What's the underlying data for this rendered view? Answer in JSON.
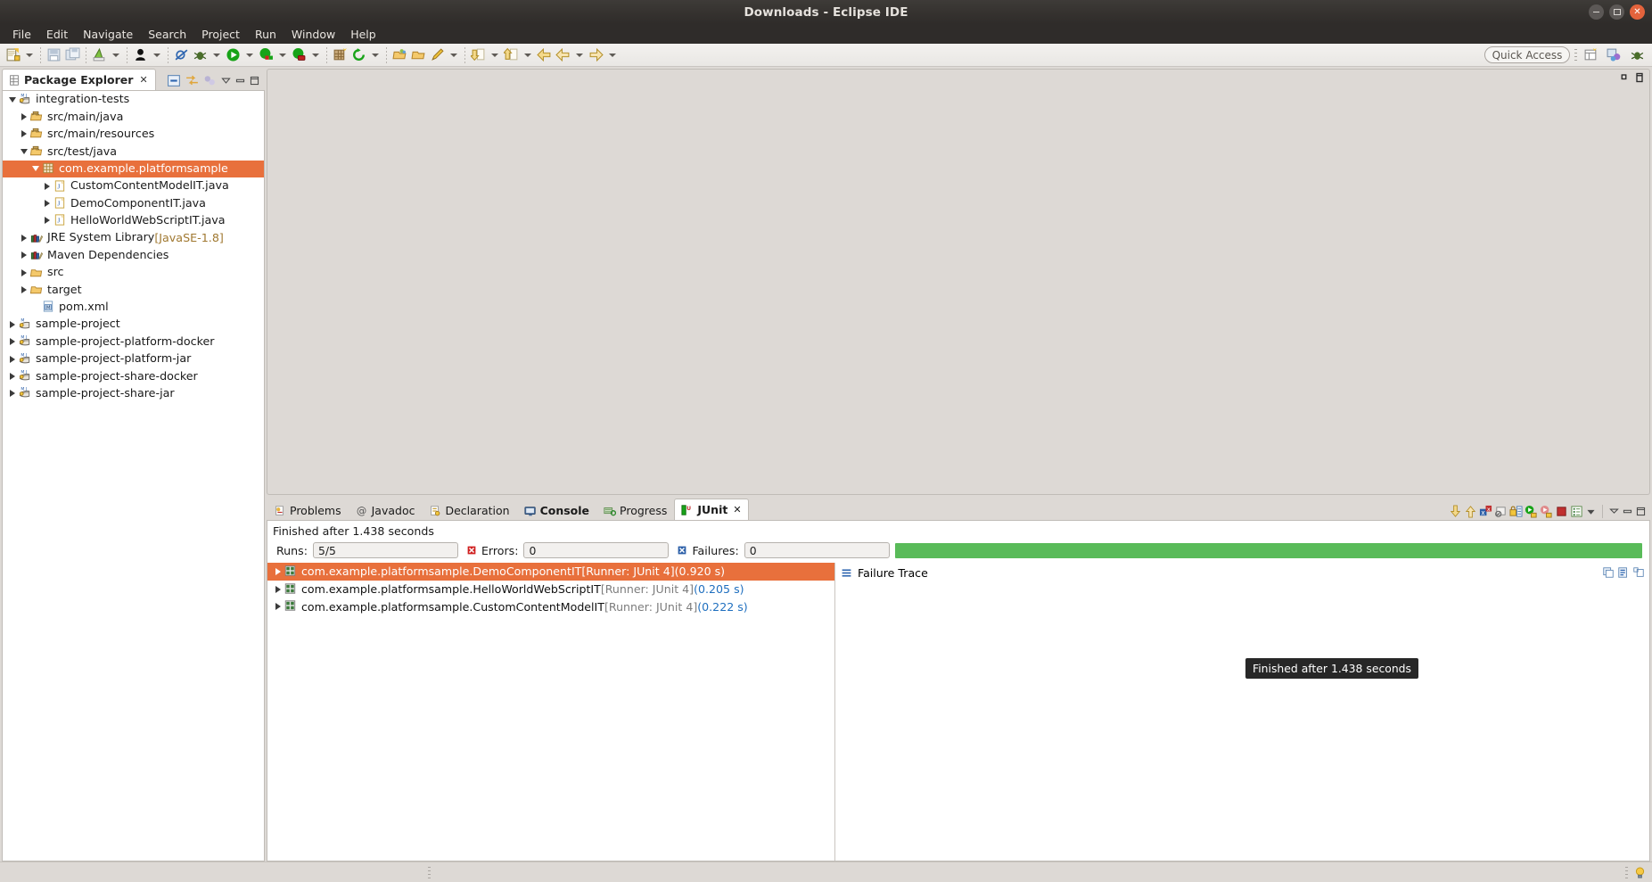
{
  "window": {
    "title": "Downloads - Eclipse IDE",
    "controls": [
      {
        "name": "minimize",
        "glyph": "–"
      },
      {
        "name": "maximize",
        "glyph": "□"
      },
      {
        "name": "close",
        "glyph": "✕"
      }
    ]
  },
  "menubar": {
    "items": [
      "File",
      "Edit",
      "Navigate",
      "Search",
      "Project",
      "Run",
      "Window",
      "Help"
    ]
  },
  "toolbar": {
    "quick_access_placeholder": "Quick Access",
    "groups": [
      {
        "icons": [
          "new-file-icon"
        ],
        "dropdown": true
      },
      {
        "icons": [
          "save-icon",
          "save-all-icon"
        ],
        "dropdown": false
      },
      {
        "icons": [
          "new-java-project-icon"
        ],
        "dropdown": true
      },
      {
        "icons": [
          "run-last-tool-icon"
        ],
        "dropdown": true
      },
      {
        "icons": [
          "skip-breakpoints-icon",
          "debug-icon"
        ],
        "dropdown": true
      },
      {
        "icons": [
          "run-icon"
        ],
        "dropdown": true
      },
      {
        "icons": [
          "coverage-icon"
        ],
        "dropdown": true
      },
      {
        "icons": [
          "run-ant-icon"
        ],
        "dropdown": true
      },
      {
        "icons": [
          "new-class-icon",
          "refresh-icon"
        ],
        "dropdown": true
      },
      {
        "icons": [
          "open-type-icon",
          "open-task-icon",
          "annotation-icon"
        ],
        "dropdown": true
      },
      {
        "icons": [
          "previous-annotation-icon"
        ],
        "dropdown": true
      },
      {
        "icons": [
          "next-annotation-icon"
        ],
        "dropdown": true
      },
      {
        "icons": [
          "back-icon",
          "forward-icon"
        ],
        "dropdown": true
      },
      {
        "icons": [
          "forward-nav-icon"
        ],
        "dropdown": true
      }
    ],
    "perspective_icons": [
      "java-perspective-icon",
      "java-ee-perspective-icon",
      "debug-perspective-icon"
    ]
  },
  "package_explorer": {
    "tab_label": "Package Explorer",
    "tab_icon": "package-explorer-icon",
    "close_glyph": "✕",
    "tools": [
      "collapse-all-icon",
      "link-with-editor-icon",
      "view-filters-icon",
      "view-menu-icon",
      "minimize-icon",
      "maximize-icon"
    ],
    "tree": [
      {
        "label": "integration-tests",
        "indent": 0,
        "twisty": "down",
        "icon": "maven-java-project-icon",
        "selected": false
      },
      {
        "label": "src/main/java",
        "indent": 1,
        "twisty": "right",
        "icon": "source-folder-icon",
        "selected": false
      },
      {
        "label": "src/main/resources",
        "indent": 1,
        "twisty": "right",
        "icon": "source-folder-icon",
        "selected": false
      },
      {
        "label": "src/test/java",
        "indent": 1,
        "twisty": "down",
        "icon": "source-folder-icon",
        "selected": false
      },
      {
        "label": "com.example.platformsample",
        "indent": 2,
        "twisty": "down",
        "icon": "package-icon",
        "selected": true
      },
      {
        "label": "CustomContentModelIT.java",
        "indent": 3,
        "twisty": "right",
        "icon": "java-file-icon",
        "selected": false
      },
      {
        "label": "DemoComponentIT.java",
        "indent": 3,
        "twisty": "right",
        "icon": "java-file-icon",
        "selected": false
      },
      {
        "label": "HelloWorldWebScriptIT.java",
        "indent": 3,
        "twisty": "right",
        "icon": "java-file-icon",
        "selected": false
      },
      {
        "label": "JRE System Library",
        "suffix": " [JavaSE-1.8]",
        "indent": 1,
        "twisty": "right",
        "icon": "library-icon",
        "selected": false
      },
      {
        "label": "Maven Dependencies",
        "indent": 1,
        "twisty": "right",
        "icon": "library-icon",
        "selected": false
      },
      {
        "label": "src",
        "indent": 1,
        "twisty": "right",
        "icon": "folder-icon",
        "selected": false
      },
      {
        "label": "target",
        "indent": 1,
        "twisty": "right",
        "icon": "folder-icon",
        "selected": false
      },
      {
        "label": "pom.xml",
        "indent": 2,
        "twisty": "none",
        "icon": "xml-file-icon",
        "selected": false
      },
      {
        "label": "sample-project",
        "indent": 0,
        "twisty": "right",
        "icon": "maven-project-icon",
        "selected": false
      },
      {
        "label": "sample-project-platform-docker",
        "indent": 0,
        "twisty": "right",
        "icon": "maven-java-project-icon",
        "selected": false
      },
      {
        "label": "sample-project-platform-jar",
        "indent": 0,
        "twisty": "right",
        "icon": "maven-java-project-icon",
        "selected": false
      },
      {
        "label": "sample-project-share-docker",
        "indent": 0,
        "twisty": "right",
        "icon": "maven-java-project-icon",
        "selected": false
      },
      {
        "label": "sample-project-share-jar",
        "indent": 0,
        "twisty": "right",
        "icon": "maven-java-project-icon",
        "selected": false
      }
    ]
  },
  "editor_area": {
    "controls": [
      "restore-icon",
      "maximize-icon"
    ]
  },
  "bottom_tabs": [
    {
      "label": "Problems",
      "icon": "problems-icon",
      "active": false,
      "bold": false
    },
    {
      "label": "Javadoc",
      "icon": "javadoc-icon",
      "active": false,
      "bold": false
    },
    {
      "label": "Declaration",
      "icon": "declaration-icon",
      "active": false,
      "bold": false
    },
    {
      "label": "Console",
      "icon": "console-icon",
      "active": false,
      "bold": true
    },
    {
      "label": "Progress",
      "icon": "progress-icon",
      "active": false,
      "bold": false
    },
    {
      "label": "JUnit",
      "icon": "junit-icon",
      "active": true,
      "bold": true,
      "close_glyph": "✕"
    }
  ],
  "junit": {
    "status_text": "Finished after 1.438 seconds",
    "runs_label": "Runs:",
    "runs_value": "5/5",
    "errors_label": "Errors:",
    "errors_value": "0",
    "failures_label": "Failures:",
    "failures_value": "0",
    "errors_icon": "error-marker-icon",
    "failures_icon": "failure-marker-icon",
    "progress_color": "#59bb59",
    "selection_color": "#e8703c",
    "tooltip_text": "Finished after 1.438 seconds",
    "toolbar_icons": [
      "next-failure-icon",
      "previous-failure-icon",
      "show-failures-only-icon",
      "show-ignored-icon",
      "lock-scroll-icon",
      "rerun-test-icon",
      "rerun-failed-icon",
      "stop-icon",
      "test-run-history-icon",
      "view-menu-icon",
      "minimize-icon",
      "maximize-icon"
    ],
    "results": [
      {
        "name": "com.example.platformsample.DemoComponentIT",
        "runner": " [Runner: JUnit 4] ",
        "time": "(0.920 s)",
        "icon": "test-suite-pass-icon",
        "selected": true
      },
      {
        "name": "com.example.platformsample.HelloWorldWebScriptIT",
        "runner": " [Runner: JUnit 4] ",
        "time": "(0.205 s)",
        "icon": "test-suite-pass-icon",
        "selected": false
      },
      {
        "name": "com.example.platformsample.CustomContentModelIT",
        "runner": " [Runner: JUnit 4] ",
        "time": "(0.222 s)",
        "icon": "test-suite-pass-icon",
        "selected": false
      }
    ],
    "failure_trace": {
      "title": "Failure Trace",
      "icon": "failure-trace-icon",
      "tools": [
        "copy-trace-icon",
        "filter-stack-trace-icon",
        "compare-result-icon"
      ]
    }
  },
  "statusbar": {
    "tip_icon": "tip-lightbulb-icon"
  }
}
